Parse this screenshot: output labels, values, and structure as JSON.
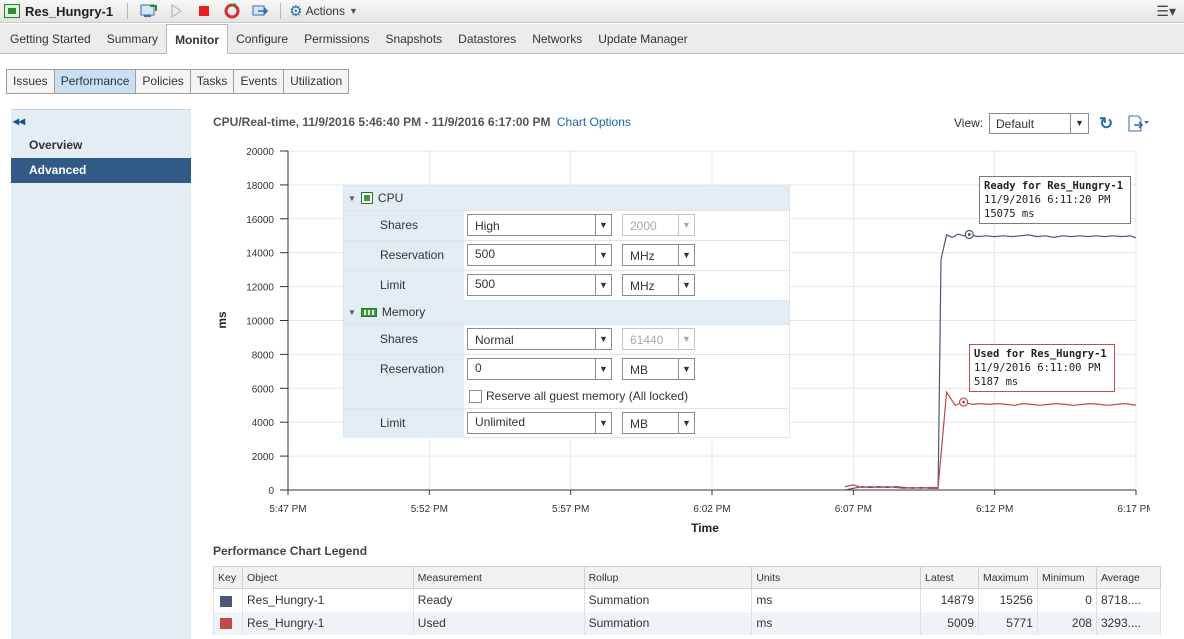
{
  "vm": {
    "name": "Res_Hungry-1",
    "actions_label": "Actions"
  },
  "tabs": [
    "Getting Started",
    "Summary",
    "Monitor",
    "Configure",
    "Permissions",
    "Snapshots",
    "Datastores",
    "Networks",
    "Update Manager"
  ],
  "active_tab": "Monitor",
  "subtabs": [
    "Issues",
    "Performance",
    "Policies",
    "Tasks",
    "Events",
    "Utilization"
  ],
  "active_subtab": "Performance",
  "sidebar": {
    "items": [
      "Overview",
      "Advanced"
    ],
    "active": "Advanced"
  },
  "chart_header": {
    "title": "CPU/Real-time, 11/9/2016 5:46:40 PM - 11/9/2016 6:17:00 PM",
    "options_link": "Chart Options",
    "view_label": "View:",
    "view_value": "Default"
  },
  "resource_panel": {
    "cpu": {
      "title": "CPU",
      "shares_label": "Shares",
      "shares_value": "High",
      "shares_number": "2000",
      "reservation_label": "Reservation",
      "reservation_value": "500",
      "reservation_unit": "MHz",
      "limit_label": "Limit",
      "limit_value": "500",
      "limit_unit": "MHz"
    },
    "memory": {
      "title": "Memory",
      "shares_label": "Shares",
      "shares_value": "Normal",
      "shares_number": "61440",
      "reservation_label": "Reservation",
      "reservation_value": "0",
      "reservation_unit": "MB",
      "reserve_all_label": "Reserve all guest memory (All locked)",
      "limit_label": "Limit",
      "limit_value": "Unlimited",
      "limit_unit": "MB"
    }
  },
  "tooltips": {
    "ready": {
      "line1": "Ready for Res_Hungry-1",
      "line2": "11/9/2016 6:11:20 PM",
      "line3": "15075 ms"
    },
    "used": {
      "line1": "Used for Res_Hungry-1",
      "line2": "11/9/2016 6:11:00 PM",
      "line3": "5187 ms"
    }
  },
  "chart_data": {
    "type": "line",
    "xlabel": "Time",
    "ylabel": "ms",
    "ylim": [
      0,
      20000
    ],
    "yticks": [
      0,
      2000,
      4000,
      6000,
      8000,
      10000,
      12000,
      14000,
      16000,
      18000,
      20000
    ],
    "xticks": [
      "5:47 PM",
      "5:52 PM",
      "5:57 PM",
      "6:02 PM",
      "6:07 PM",
      "6:12 PM",
      "6:17 PM"
    ],
    "grid": true,
    "series": [
      {
        "name": "Ready",
        "color": "#4a5878",
        "points": [
          [
            19.7,
            0
          ],
          [
            20.0,
            100
          ],
          [
            20.3,
            200
          ],
          [
            20.6,
            150
          ],
          [
            20.9,
            200
          ],
          [
            21.2,
            150
          ],
          [
            21.5,
            200
          ],
          [
            21.8,
            150
          ],
          [
            22.1,
            100
          ],
          [
            22.4,
            150
          ],
          [
            22.7,
            100
          ],
          [
            23.0,
            100
          ],
          [
            23.1,
            13600
          ],
          [
            23.3,
            15050
          ],
          [
            23.5,
            14900
          ],
          [
            23.7,
            15100
          ],
          [
            23.9,
            15000
          ],
          [
            24.1,
            15075
          ],
          [
            24.4,
            14950
          ],
          [
            24.7,
            15000
          ],
          [
            25.0,
            14950
          ],
          [
            25.3,
            15000
          ],
          [
            25.6,
            14950
          ],
          [
            25.9,
            15000
          ],
          [
            26.2,
            15050
          ],
          [
            26.5,
            14950
          ],
          [
            26.8,
            15000
          ],
          [
            27.1,
            14900
          ],
          [
            27.4,
            15000
          ],
          [
            27.7,
            14950
          ],
          [
            28.0,
            15000
          ],
          [
            28.3,
            14950
          ],
          [
            28.6,
            15000
          ],
          [
            28.9,
            14950
          ],
          [
            29.2,
            15000
          ],
          [
            29.5,
            14950
          ],
          [
            29.8,
            15000
          ],
          [
            30.0,
            14879
          ]
        ]
      },
      {
        "name": "Used",
        "color": "#c04a4a",
        "points": [
          [
            19.7,
            200
          ],
          [
            20.0,
            300
          ],
          [
            20.3,
            150
          ],
          [
            20.6,
            200
          ],
          [
            20.9,
            150
          ],
          [
            21.2,
            200
          ],
          [
            21.5,
            150
          ],
          [
            21.8,
            100
          ],
          [
            22.1,
            150
          ],
          [
            22.4,
            100
          ],
          [
            22.7,
            150
          ],
          [
            23.0,
            150
          ],
          [
            23.3,
            5771
          ],
          [
            23.6,
            5000
          ],
          [
            23.9,
            5187
          ],
          [
            24.2,
            5050
          ],
          [
            24.5,
            5100
          ],
          [
            24.8,
            5050
          ],
          [
            25.1,
            5100
          ],
          [
            25.4,
            5050
          ],
          [
            25.7,
            5000
          ],
          [
            26.0,
            5100
          ],
          [
            26.3,
            5050
          ],
          [
            26.6,
            5000
          ],
          [
            26.9,
            5050
          ],
          [
            27.2,
            5100
          ],
          [
            27.5,
            5050
          ],
          [
            27.8,
            5000
          ],
          [
            28.1,
            5050
          ],
          [
            28.4,
            5100
          ],
          [
            28.7,
            5050
          ],
          [
            29.0,
            5000
          ],
          [
            29.3,
            5050
          ],
          [
            29.6,
            5100
          ],
          [
            30.0,
            5009
          ]
        ]
      }
    ],
    "markers": [
      {
        "series": "Ready",
        "x": 24.1,
        "y": 15075
      },
      {
        "series": "Used",
        "x": 23.9,
        "y": 5187
      }
    ]
  },
  "legend": {
    "title": "Performance Chart Legend",
    "columns": [
      "Key",
      "Object",
      "Measurement",
      "Rollup",
      "Units",
      "Latest",
      "Maximum",
      "Minimum",
      "Average"
    ],
    "rows": [
      {
        "color": "#4a5878",
        "object": "Res_Hungry-1",
        "measurement": "Ready",
        "rollup": "Summation",
        "units": "ms",
        "latest": "14879",
        "maximum": "15256",
        "minimum": "0",
        "average": "8718...."
      },
      {
        "color": "#c04a4a",
        "object": "Res_Hungry-1",
        "measurement": "Used",
        "rollup": "Summation",
        "units": "ms",
        "latest": "5009",
        "maximum": "5771",
        "minimum": "208",
        "average": "3293...."
      }
    ]
  }
}
